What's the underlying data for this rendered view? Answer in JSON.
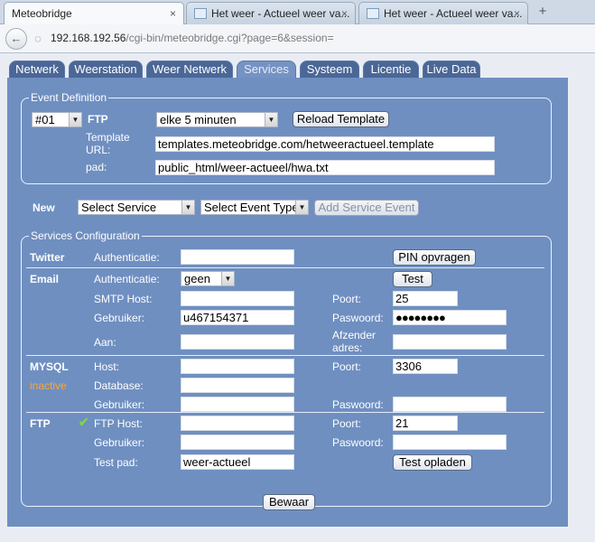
{
  "browser": {
    "tabs": [
      {
        "label": "Meteobridge"
      },
      {
        "label": "Het weer - Actueel weer va..."
      },
      {
        "label": "Het weer - Actueel weer va..."
      }
    ],
    "close_glyph": "×",
    "newtab_glyph": "+",
    "url_host": "192.168.192.56",
    "url_path": "/cgi-bin/meteobridge.cgi?page=6&session="
  },
  "nav": {
    "tabs": [
      "Netwerk",
      "Weerstation",
      "Weer Netwerk",
      "Services",
      "Systeem",
      "Licentie",
      "Live Data"
    ],
    "active": "Services"
  },
  "event_definition": {
    "legend": "Event Definition",
    "event_no": "#01",
    "service": "FTP",
    "interval": "elke 5 minuten",
    "reload_button": "Reload Template",
    "template_label": "Template URL:",
    "template_value": "templates.meteobridge.com/hetweeractueel.template",
    "path_label": "pad:",
    "path_value": "public_html/weer-actueel/hwa.txt"
  },
  "new_event": {
    "label": "New",
    "service_select": "Select Service",
    "event_type_select": "Select Event Type",
    "add_button": "Add Service Event"
  },
  "services": {
    "legend": "Services Configuration",
    "twitter": {
      "label": "Twitter",
      "auth_label": "Authenticatie:",
      "auth_value": "",
      "pin_button": "PIN opvragen"
    },
    "email": {
      "label": "Email",
      "auth_label": "Authenticatie:",
      "auth_value": "geen",
      "test_button": "Test",
      "smtp_label": "SMTP Host:",
      "smtp_value": "",
      "port_label": "Poort:",
      "port_value": "25",
      "user_label": "Gebruiker:",
      "user_value": "u467154371",
      "password_label": "Paswoord:",
      "password_value": "●●●●●●●●",
      "to_label": "Aan:",
      "to_value": "",
      "from_label": "Afzender adres:",
      "from_value": ""
    },
    "mysql": {
      "label": "MYSQL",
      "status": "inactive",
      "host_label": "Host:",
      "host_value": "",
      "port_label": "Poort:",
      "port_value": "3306",
      "db_label": "Database:",
      "db_value": "",
      "user_label": "Gebruiker:",
      "user_value": "",
      "password_label": "Paswoord:",
      "password_value": ""
    },
    "ftp": {
      "label": "FTP",
      "check_glyph": "✔",
      "host_label": "FTP Host:",
      "host_value": "",
      "port_label": "Poort:",
      "port_value": "21",
      "user_label": "Gebruiker:",
      "user_value": "",
      "password_label": "Paswoord:",
      "password_value": "",
      "testpath_label": "Test pad:",
      "testpath_value": "weer-actueel",
      "upload_button": "Test opladen"
    }
  },
  "save_button": "Bewaar",
  "colors": {
    "panel": "#6f8fc1",
    "nav_tab": "#4b6797",
    "inactive_status": "#f7a838",
    "ftp_ok": "#7fd44a"
  }
}
